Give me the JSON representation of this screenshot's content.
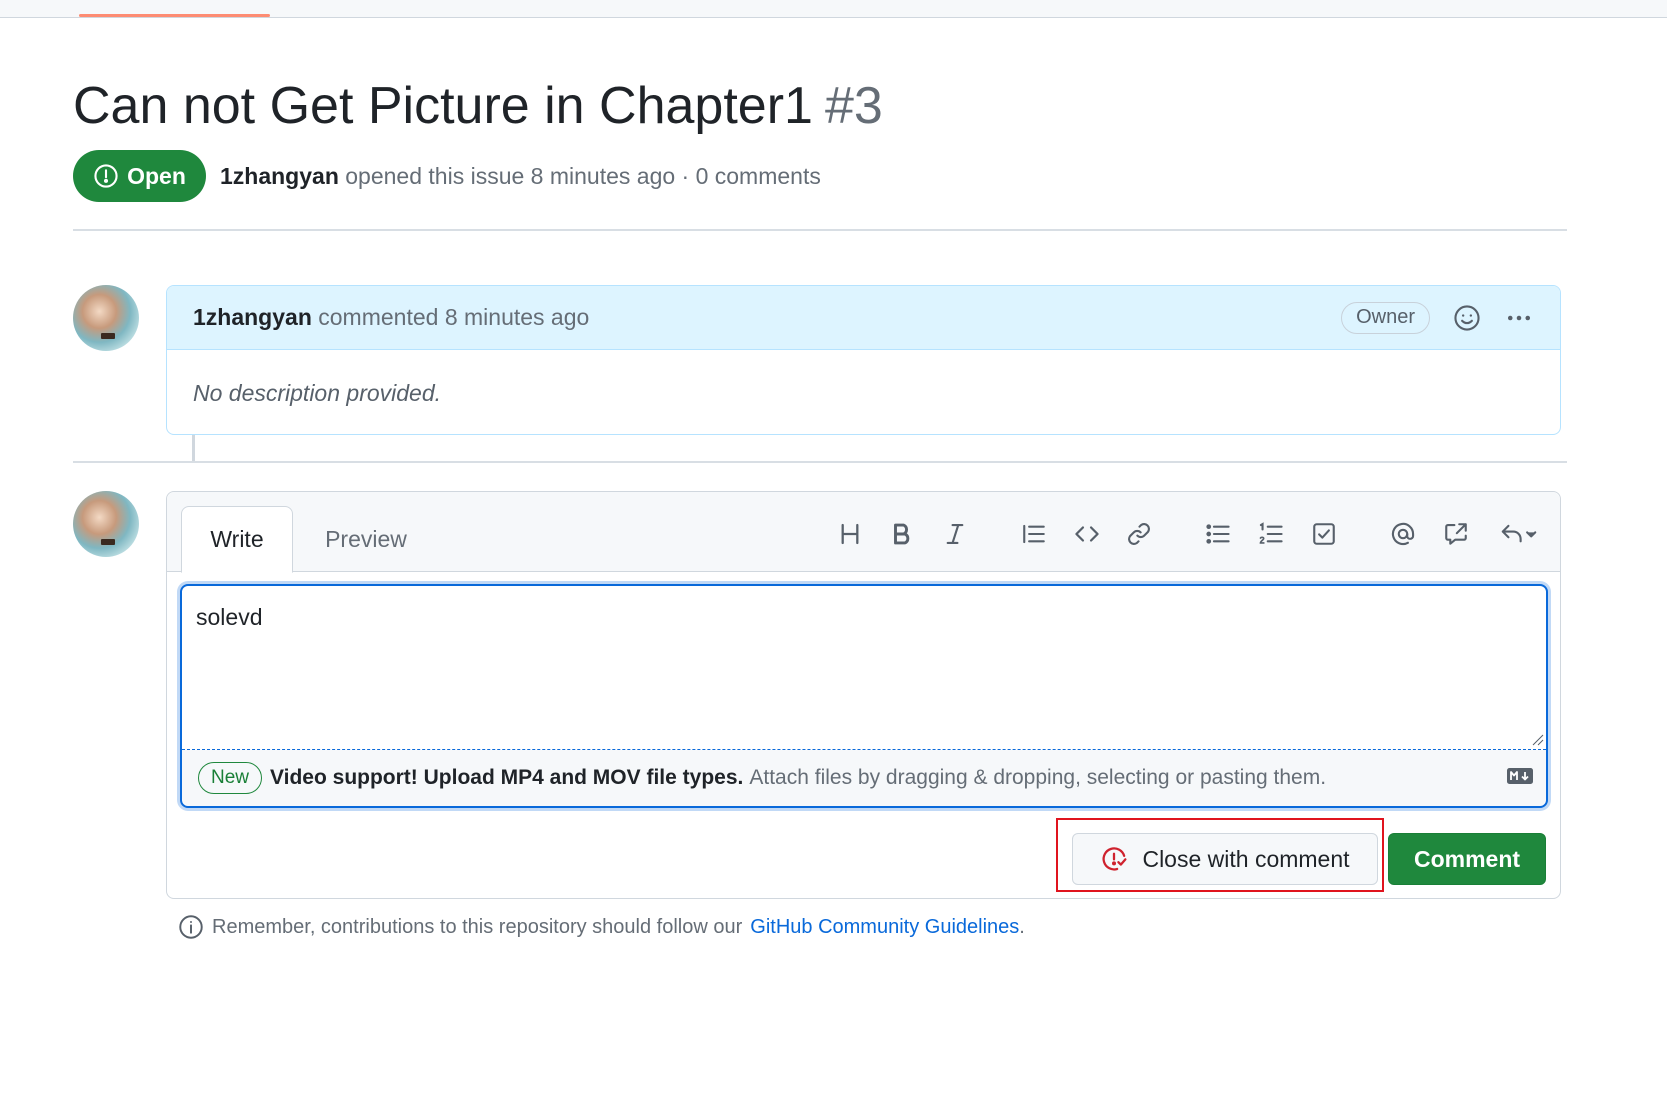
{
  "issue": {
    "title": "Can not Get Picture in Chapter1",
    "number": "#3",
    "state": "Open",
    "author": "1zhangyan",
    "meta_text": "opened this issue 8 minutes ago · 0 comments"
  },
  "comment": {
    "author": "1zhangyan",
    "action": "commented 8 minutes ago",
    "role_badge": "Owner",
    "body": "No description provided."
  },
  "editor": {
    "tabs": [
      "Write",
      "Preview"
    ],
    "text_value": "solevd",
    "new_badge": "New",
    "file_notice_bold": "Video support! Upload MP4 and MOV file types.",
    "file_notice": "Attach files by dragging & dropping, selecting or pasting them.",
    "toolbar_icons": [
      "heading-icon",
      "bold-icon",
      "italic-icon",
      "quote-icon",
      "code-icon",
      "link-icon",
      "unordered-list-icon",
      "ordered-list-icon",
      "task-list-icon",
      "mention-icon",
      "cross-reference-icon",
      "reply-icon"
    ]
  },
  "actions": {
    "close_with_comment": "Close with comment",
    "comment": "Comment"
  },
  "footer": {
    "note": "Remember, contributions to this repository should follow our",
    "link": "GitHub Community Guidelines",
    "period": "."
  },
  "colors": {
    "open_green": "#1f883d",
    "link_blue": "#0969da",
    "close_red": "#cf222e",
    "highlight_red": "#e0141e"
  }
}
